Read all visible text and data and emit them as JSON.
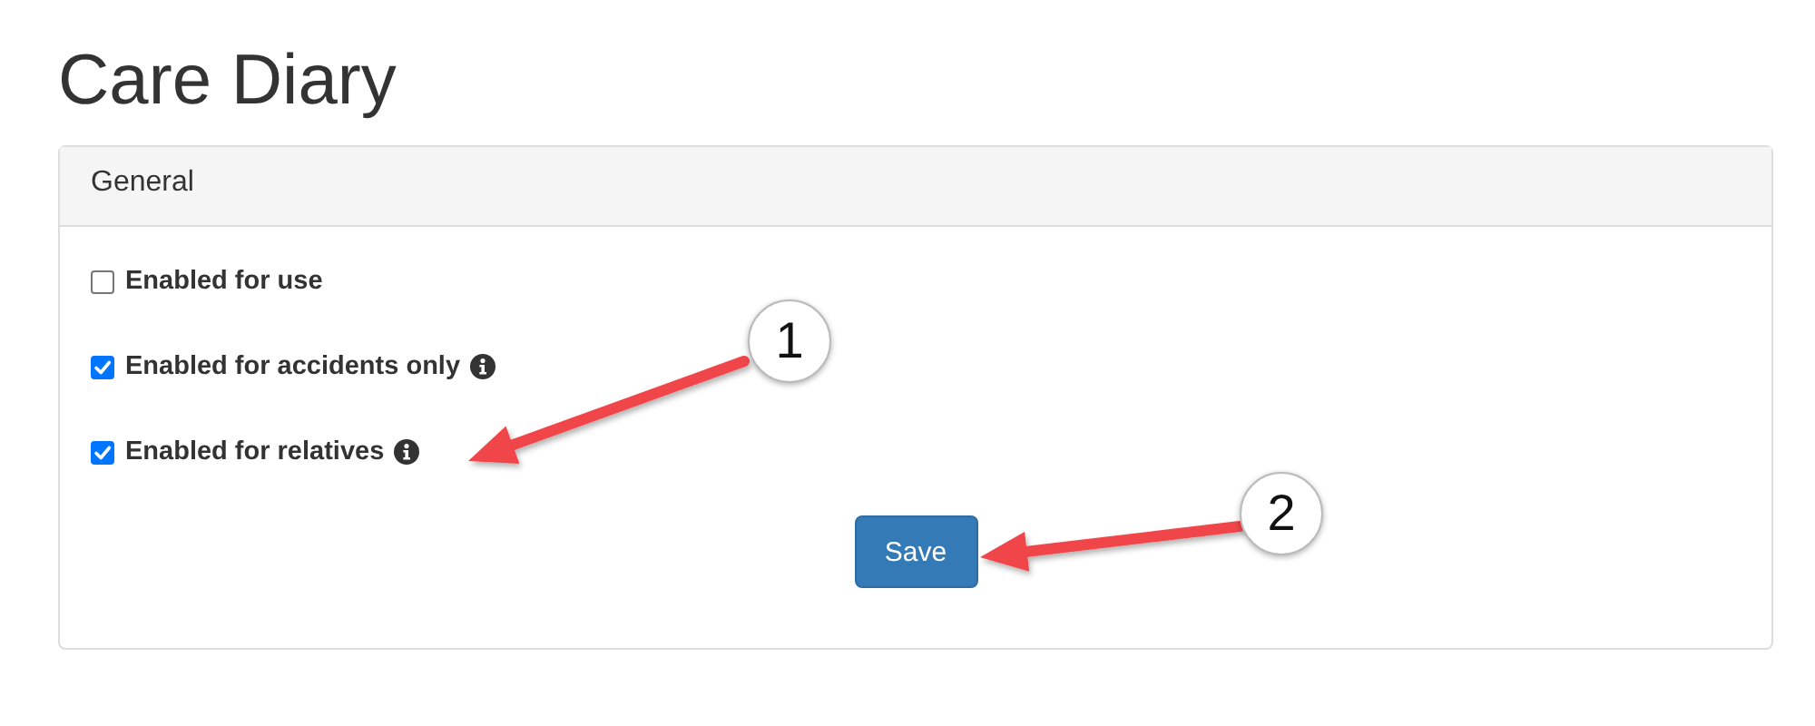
{
  "page": {
    "title": "Care Diary"
  },
  "panel": {
    "heading": "General",
    "options": [
      {
        "label": "Enabled for use",
        "checked": false,
        "info": false
      },
      {
        "label": "Enabled for accidents only",
        "checked": true,
        "info": true
      },
      {
        "label": "Enabled for relatives",
        "checked": true,
        "info": true
      }
    ],
    "save_button": "Save"
  },
  "callouts": [
    {
      "number": "1"
    },
    {
      "number": "2"
    }
  ]
}
